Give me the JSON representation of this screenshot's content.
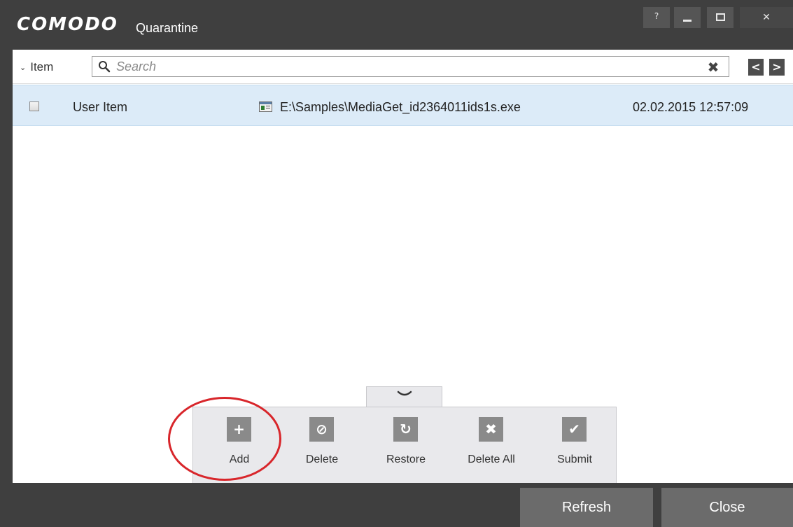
{
  "window": {
    "brand": "COMODO",
    "title": "Quarantine",
    "controls": {
      "help": "?",
      "close": "✕"
    }
  },
  "toolbar": {
    "filter_label": "Item",
    "search_placeholder": "Search",
    "clear_symbol": "✖",
    "prev_symbol": "<",
    "next_symbol": ">"
  },
  "items": [
    {
      "type": "User Item",
      "path": "E:\\Samples\\MediaGet_id2364011ids1s.exe",
      "date": "02.02.2015 12:57:09",
      "checked": false
    }
  ],
  "actions": {
    "add": {
      "label": "Add",
      "icon": "plus-icon",
      "symbol": "+"
    },
    "delete": {
      "label": "Delete",
      "icon": "block-icon",
      "symbol": "⊘"
    },
    "restore": {
      "label": "Restore",
      "icon": "restore-icon",
      "symbol": "↻"
    },
    "delete_all": {
      "label": "Delete All",
      "icon": "x-icon",
      "symbol": "✖"
    },
    "submit": {
      "label": "Submit",
      "icon": "check-icon",
      "symbol": "✔"
    }
  },
  "footer": {
    "refresh_label": "Refresh",
    "close_label": "Close"
  },
  "colors": {
    "titlebar": "#3f3f3f",
    "row_selected": "#dcebf8",
    "panel": "#e9e9ec",
    "icon_gray": "#8a8a8a",
    "button": "#6b6b6b",
    "highlight": "#d8262b"
  }
}
